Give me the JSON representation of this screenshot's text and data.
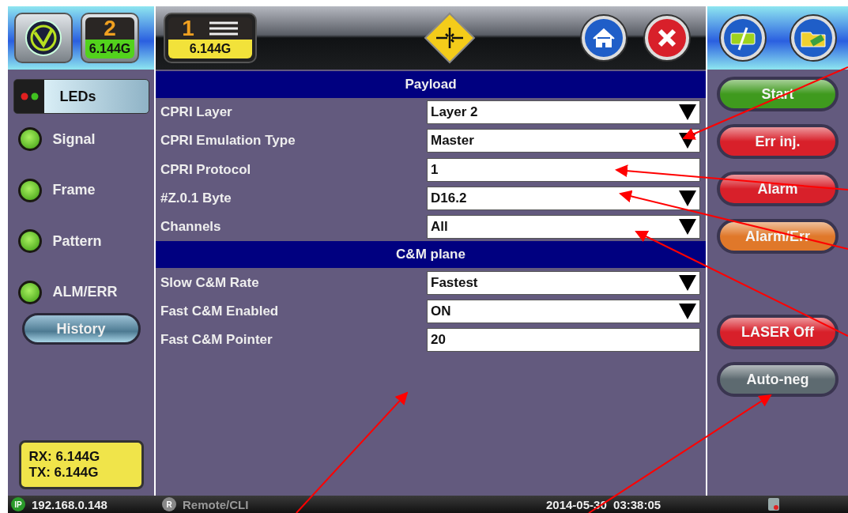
{
  "top_bar": {
    "port_2": {
      "number": "2",
      "rate": "6.144G"
    },
    "port_1": {
      "number": "1",
      "rate": "6.144G"
    }
  },
  "leds_panel": {
    "button": "LEDs",
    "leds": [
      {
        "label": "Signal",
        "on": true
      },
      {
        "label": "Frame",
        "on": true
      },
      {
        "label": "Pattern",
        "on": true
      },
      {
        "label": "ALM/ERR",
        "on": true
      }
    ],
    "history_button": "History",
    "rx": "RX: 6.144G",
    "tx": "TX: 6.144G"
  },
  "sections": [
    {
      "title": "Payload",
      "rows": [
        {
          "label": "CPRI Layer",
          "value": "Layer 2",
          "kind": "dropdown"
        },
        {
          "label": "CPRI Emulation Type",
          "value": "Master",
          "kind": "dropdown"
        },
        {
          "label": "CPRI Protocol",
          "value": "1",
          "kind": "text"
        },
        {
          "label": "#Z.0.1 Byte",
          "value": "D16.2",
          "kind": "dropdown"
        },
        {
          "label": "Channels",
          "value": "All",
          "kind": "dropdown"
        }
      ]
    },
    {
      "title": "C&M plane",
      "rows": [
        {
          "label": "Slow C&M Rate",
          "value": "Fastest",
          "kind": "dropdown"
        },
        {
          "label": "Fast C&M Enabled",
          "value": "ON",
          "kind": "dropdown"
        },
        {
          "label": "Fast C&M Pointer",
          "value": "20",
          "kind": "text"
        }
      ]
    }
  ],
  "actions": [
    {
      "label": "Start",
      "color": "#3f9a1e"
    },
    {
      "label": "Err inj.",
      "color": "#d8202a"
    },
    {
      "label": "Alarm",
      "color": "#d8202a"
    },
    {
      "label": "Alarm/Err",
      "color": "#e0782a"
    },
    {
      "label": "LASER Off",
      "color": "#d8202a"
    },
    {
      "label": "Auto-neg",
      "color": "#5d6a70"
    }
  ],
  "status_bar": {
    "ip_badge": "IP",
    "ip": "192.168.0.148",
    "remote_badge": "R",
    "remote": "Remote/CLI",
    "datetime": "2014-05-30  03:38:05"
  }
}
